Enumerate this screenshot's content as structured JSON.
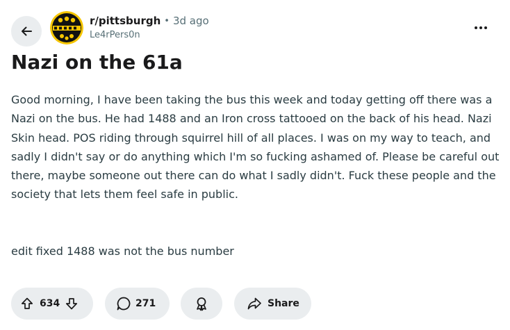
{
  "post": {
    "subreddit": "r/pittsburgh",
    "separator": "•",
    "time_ago": "3d ago",
    "author": "Le4rPers0n",
    "title": "Nazi on the 61a",
    "body": "Good morning, I have been taking the bus this week and today getting off there was a Nazi on the bus. He had 1488 and an Iron cross tattooed on the back of his head. Nazi Skin head. POS riding through squirrel hill of all places. I was on my way to teach, and sadly I didn't say or do anything which I'm so fucking ashamed of. Please be careful out there, maybe someone out there can do what I sadly didn't. Fuck these people and the society that lets them feel safe in public.",
    "edit": "edit fixed 1488 was not the bus number"
  },
  "actions": {
    "votes": "634",
    "comments": "271",
    "share_label": "Share"
  },
  "icons": {
    "back": "arrow-left-icon",
    "more": "ellipsis-icon",
    "upvote": "arrow-up-icon",
    "downvote": "arrow-down-icon",
    "comment": "speech-bubble-icon",
    "award": "award-icon",
    "share": "share-arrow-icon"
  },
  "colors": {
    "pill_bg": "#eaedef",
    "text_primary": "#1a1a1b",
    "text_secondary": "#576f76",
    "body_text": "#2a3c42",
    "avatar_yellow": "#f5c500",
    "avatar_black": "#111111"
  }
}
